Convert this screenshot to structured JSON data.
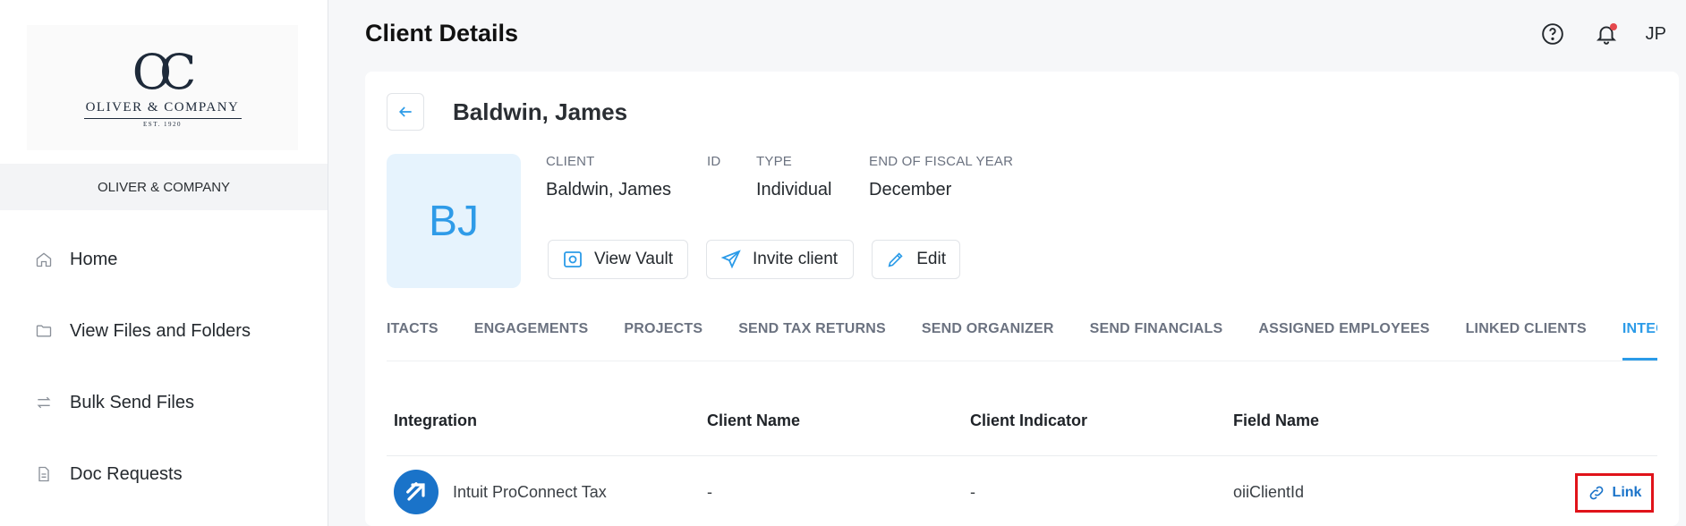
{
  "sidebar": {
    "logo": {
      "monogram": "OC",
      "name": "OLIVER & COMPANY",
      "est": "EST. 1920"
    },
    "org_name": "OLIVER & COMPANY",
    "items": [
      {
        "label": "Home",
        "icon": "home-icon"
      },
      {
        "label": "View Files and Folders",
        "icon": "folder-icon"
      },
      {
        "label": "Bulk Send Files",
        "icon": "arrows-exchange-icon"
      },
      {
        "label": "Doc Requests",
        "icon": "document-icon"
      }
    ]
  },
  "header": {
    "title": "Client Details",
    "user_initials": "JP",
    "icons": [
      "help-icon",
      "bell-icon"
    ]
  },
  "client": {
    "name": "Baldwin, James",
    "initials": "BJ",
    "meta": {
      "client_label": "CLIENT",
      "client_value": "Baldwin, James",
      "id_label": "ID",
      "id_value": "",
      "type_label": "TYPE",
      "type_value": "Individual",
      "fiscal_label": "END OF FISCAL YEAR",
      "fiscal_value": "December"
    },
    "actions": {
      "view_vault": "View Vault",
      "invite_client": "Invite client",
      "edit": "Edit"
    }
  },
  "tabs": [
    {
      "label": "ITACTS",
      "active": false
    },
    {
      "label": "ENGAGEMENTS",
      "active": false
    },
    {
      "label": "PROJECTS",
      "active": false
    },
    {
      "label": "SEND TAX RETURNS",
      "active": false
    },
    {
      "label": "SEND ORGANIZER",
      "active": false
    },
    {
      "label": "SEND FINANCIALS",
      "active": false
    },
    {
      "label": "ASSIGNED EMPLOYEES",
      "active": false
    },
    {
      "label": "LINKED CLIENTS",
      "active": false
    },
    {
      "label": "INTEGRATION CLIENTS",
      "active": true
    }
  ],
  "table": {
    "columns": [
      "Integration",
      "Client Name",
      "Client Indicator",
      "Field Name"
    ],
    "rows": [
      {
        "integration": "Intuit ProConnect Tax",
        "client_name": "-",
        "client_indicator": "-",
        "field_name": "oiiClientId",
        "action": "Link"
      }
    ]
  },
  "colors": {
    "accent": "#2b9be8",
    "avatar_bg": "#e6f3fd",
    "highlight": "#e0131a",
    "integration_logo": "#1a73c9"
  }
}
